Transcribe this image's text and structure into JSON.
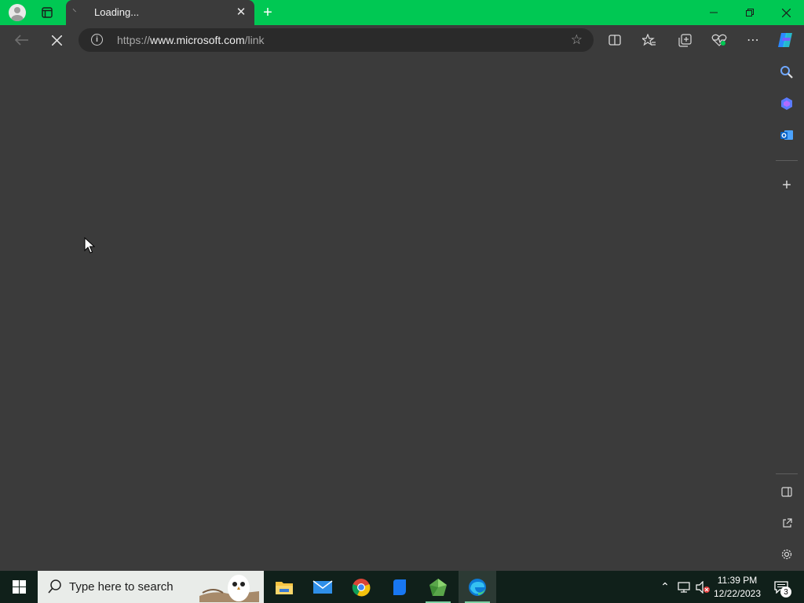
{
  "browser": {
    "tab": {
      "title": "Loading..."
    },
    "address_bar": {
      "url_prefix": "https://",
      "url_domain": "www.microsoft.com",
      "url_path": "/link"
    },
    "accent_color": "#00c853"
  },
  "taskbar": {
    "search_placeholder": "Type here to search",
    "apps": [
      "file-explorer",
      "mail",
      "chrome",
      "blue-app",
      "green-app",
      "edge"
    ],
    "clock_time": "11:39 PM",
    "clock_date": "12/22/2023",
    "notification_count": "3"
  }
}
